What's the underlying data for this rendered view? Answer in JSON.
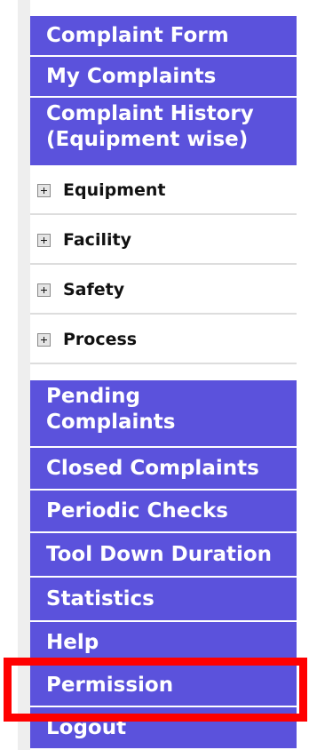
{
  "menu": {
    "top_items": [
      {
        "label": "Complaint Form"
      },
      {
        "label": "My Complaints"
      },
      {
        "label": "Complaint History\n(Equipment wise)"
      }
    ],
    "tree_items": [
      {
        "label": "Equipment",
        "icon": "plus-expander-icon"
      },
      {
        "label": "Facility",
        "icon": "plus-expander-icon"
      },
      {
        "label": "Safety",
        "icon": "plus-expander-icon"
      },
      {
        "label": "Process",
        "icon": "plus-expander-icon"
      }
    ],
    "bottom_items": [
      {
        "label": "Pending\nComplaints"
      },
      {
        "label": "Closed Complaints"
      },
      {
        "label": "Periodic Checks"
      },
      {
        "label": "Tool Down Duration"
      },
      {
        "label": "Statistics"
      },
      {
        "label": "Help"
      },
      {
        "label": "Permission"
      },
      {
        "label": "Logout"
      }
    ]
  },
  "colors": {
    "nav_bg": "#5b52dc",
    "nav_text": "#ffffff",
    "highlight": "#ff0000"
  }
}
